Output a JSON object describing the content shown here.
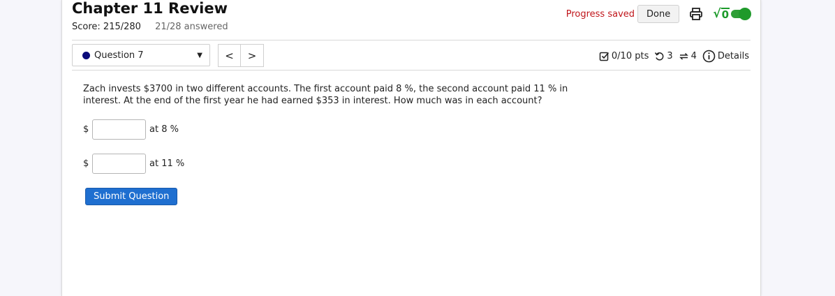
{
  "header": {
    "title": "Chapter 11 Review",
    "score": "Score: 215/280",
    "answered": "21/28 answered",
    "progress_saved": "Progress saved",
    "done_label": "Done",
    "icons": [
      "print-icon",
      "sqrt-toggle-icon"
    ]
  },
  "question_nav": {
    "selected": "Question 7",
    "prev_label": "<",
    "next_label": ">"
  },
  "question_info": {
    "points": "0/10 pts",
    "retries": "3",
    "attempts": "4",
    "details_label": "Details"
  },
  "question": {
    "text": "Zach invests $3700 in two different accounts. The first account paid 8 %, the second account paid 11 % in interest. At the end of the first year he had earned $353 in interest. How much was in each account?",
    "answers": [
      {
        "prefix": "$",
        "value": "",
        "suffix": "at 8 %"
      },
      {
        "prefix": "$",
        "value": "",
        "suffix": "at 11 %"
      }
    ],
    "submit_label": "Submit Question"
  },
  "colors": {
    "saved_red": "#c0161b",
    "submit_blue": "#1f6fd0",
    "toggle_green": "#1f9a2b",
    "question_dot": "#0a0a7a"
  }
}
